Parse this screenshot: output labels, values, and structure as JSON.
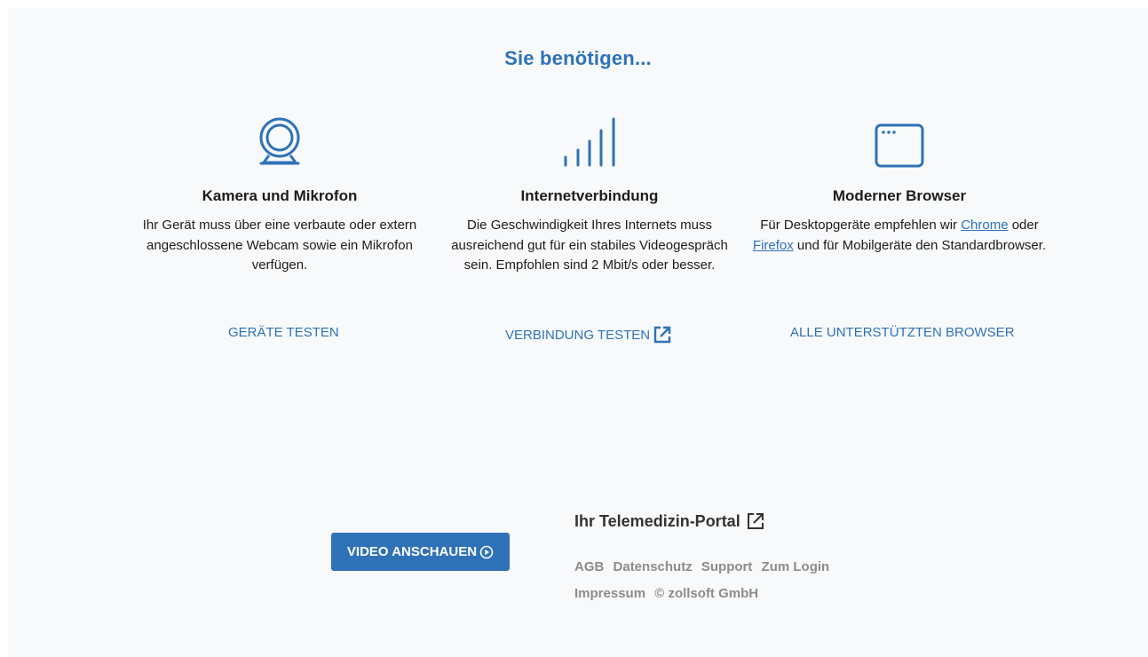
{
  "heading": "Sie benötigen...",
  "requirements": [
    {
      "icon": "webcam-icon",
      "title": "Kamera und Mikrofon",
      "text": "Ihr Gerät muss über eine verbaute oder extern angeschlossene Webcam sowie ein Mikrofon verfügen.",
      "action": "GERÄTE TESTEN"
    },
    {
      "icon": "signal-icon",
      "title": "Internetverbindung",
      "text": "Die Geschwindigkeit Ihres Internets muss ausreichend gut für ein stabiles Videogespräch sein. Empfohlen sind 2 Mbit/s oder besser.",
      "action": "VERBINDUNG TESTEN"
    },
    {
      "icon": "browser-window-icon",
      "title": "Moderner Browser",
      "text_parts": {
        "before": "Für Desktopgeräte empfehlen wir ",
        "link1": "Chrome",
        "middle": " oder ",
        "link2": "Firefox",
        "after": " und für Mobilgeräte den Standardbrowser."
      },
      "action": "ALLE UNTERSTÜTZTEN BROWSER"
    }
  ],
  "video_button": "VIDEO ANSCHAUEN",
  "portal": {
    "title": "Ihr Telemedizin-Portal",
    "links": [
      "AGB",
      "Datenschutz",
      "Support",
      "Zum Login",
      "Impressum"
    ],
    "copyright": "© zollsoft GmbH"
  },
  "colors": {
    "accent": "#2f72b7",
    "background": "#f7f9fb",
    "muted": "#8c8c8c"
  }
}
